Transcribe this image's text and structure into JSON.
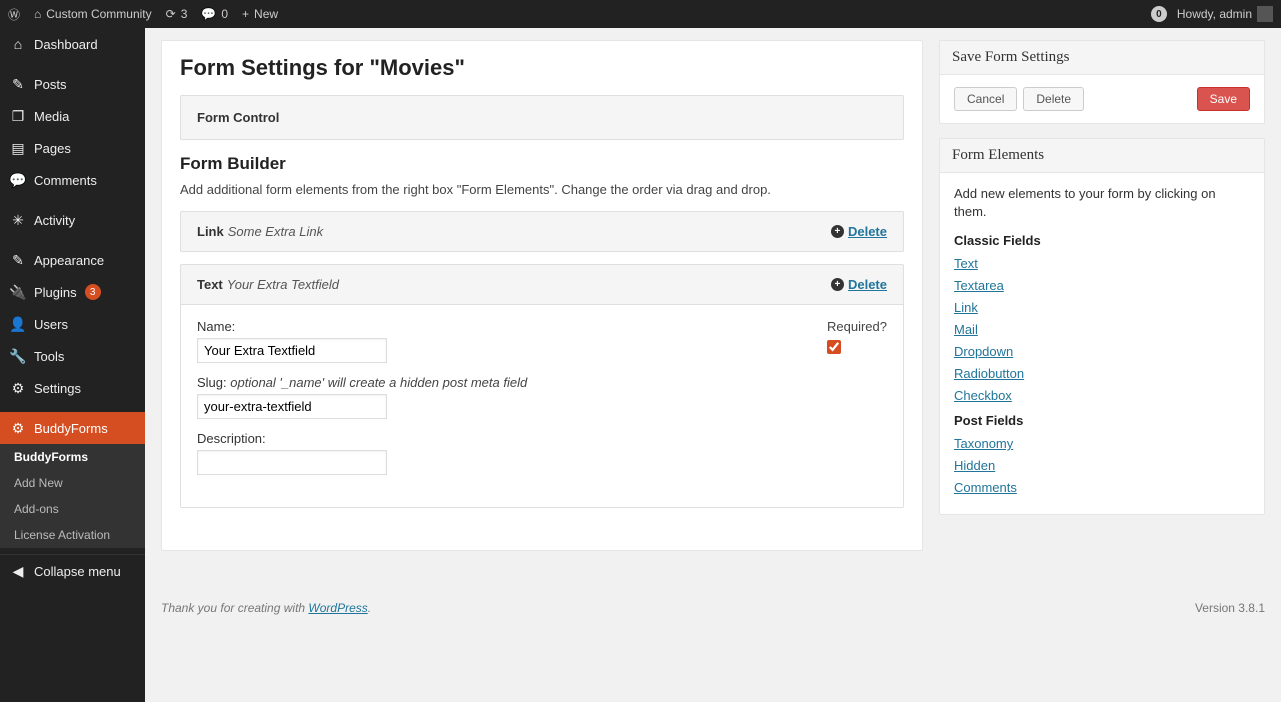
{
  "adminbar": {
    "site_name": "Custom Community",
    "updates_count": "3",
    "comments_count": "0",
    "new_label": "New",
    "notifications_count": "0",
    "howdy": "Howdy, admin"
  },
  "sidebar": {
    "items": [
      {
        "key": "dashboard",
        "label": "Dashboard",
        "icon": "⌂"
      },
      {
        "key": "posts",
        "label": "Posts",
        "icon": "✎"
      },
      {
        "key": "media",
        "label": "Media",
        "icon": "❐"
      },
      {
        "key": "pages",
        "label": "Pages",
        "icon": "▤"
      },
      {
        "key": "comments",
        "label": "Comments",
        "icon": "💬"
      },
      {
        "key": "activity",
        "label": "Activity",
        "icon": "✳"
      },
      {
        "key": "appearance",
        "label": "Appearance",
        "icon": "✎"
      },
      {
        "key": "plugins",
        "label": "Plugins",
        "icon": "🔌",
        "count": "3"
      },
      {
        "key": "users",
        "label": "Users",
        "icon": "👤"
      },
      {
        "key": "tools",
        "label": "Tools",
        "icon": "🔧"
      },
      {
        "key": "settings",
        "label": "Settings",
        "icon": "⚙"
      },
      {
        "key": "buddyforms",
        "label": "BuddyForms",
        "icon": "⚙",
        "active": true
      }
    ],
    "submenu": [
      {
        "label": "BuddyForms",
        "current": true
      },
      {
        "label": "Add New"
      },
      {
        "label": "Add-ons"
      },
      {
        "label": "License Activation"
      }
    ],
    "collapse_label": "Collapse menu"
  },
  "page": {
    "title": "Form Settings for \"Movies\"",
    "form_control_label": "Form Control",
    "builder_title": "Form Builder",
    "builder_help": "Add additional form elements from the right box \"Form Elements\". Change the order via drag and drop.",
    "delete_label": "Delete",
    "fields": [
      {
        "type": "Link",
        "name": "Some Extra Link",
        "open": false
      },
      {
        "type": "Text",
        "name": "Your Extra Textfield",
        "open": true
      }
    ],
    "editor": {
      "name_label": "Name:",
      "name_value": "Your Extra Textfield",
      "slug_label": "Slug:",
      "slug_hint": "optional '_name' will create a hidden post meta field",
      "slug_value": "your-extra-textfield",
      "desc_label": "Description:",
      "desc_value": "",
      "required_label": "Required?",
      "required_checked": true
    }
  },
  "savebox": {
    "title": "Save Form Settings",
    "cancel": "Cancel",
    "delete": "Delete",
    "save": "Save"
  },
  "elements": {
    "title": "Form Elements",
    "intro": "Add new elements to your form by clicking on them.",
    "classic_heading": "Classic Fields",
    "classic": [
      "Text",
      "Textarea",
      "Link",
      "Mail",
      "Dropdown",
      "Radiobutton",
      "Checkbox"
    ],
    "post_heading": "Post Fields",
    "post": [
      "Taxonomy",
      "Hidden",
      "Comments"
    ]
  },
  "footer": {
    "thanks": "Thank you for creating with ",
    "wp": "WordPress",
    "period": ".",
    "version": "Version 3.8.1"
  }
}
